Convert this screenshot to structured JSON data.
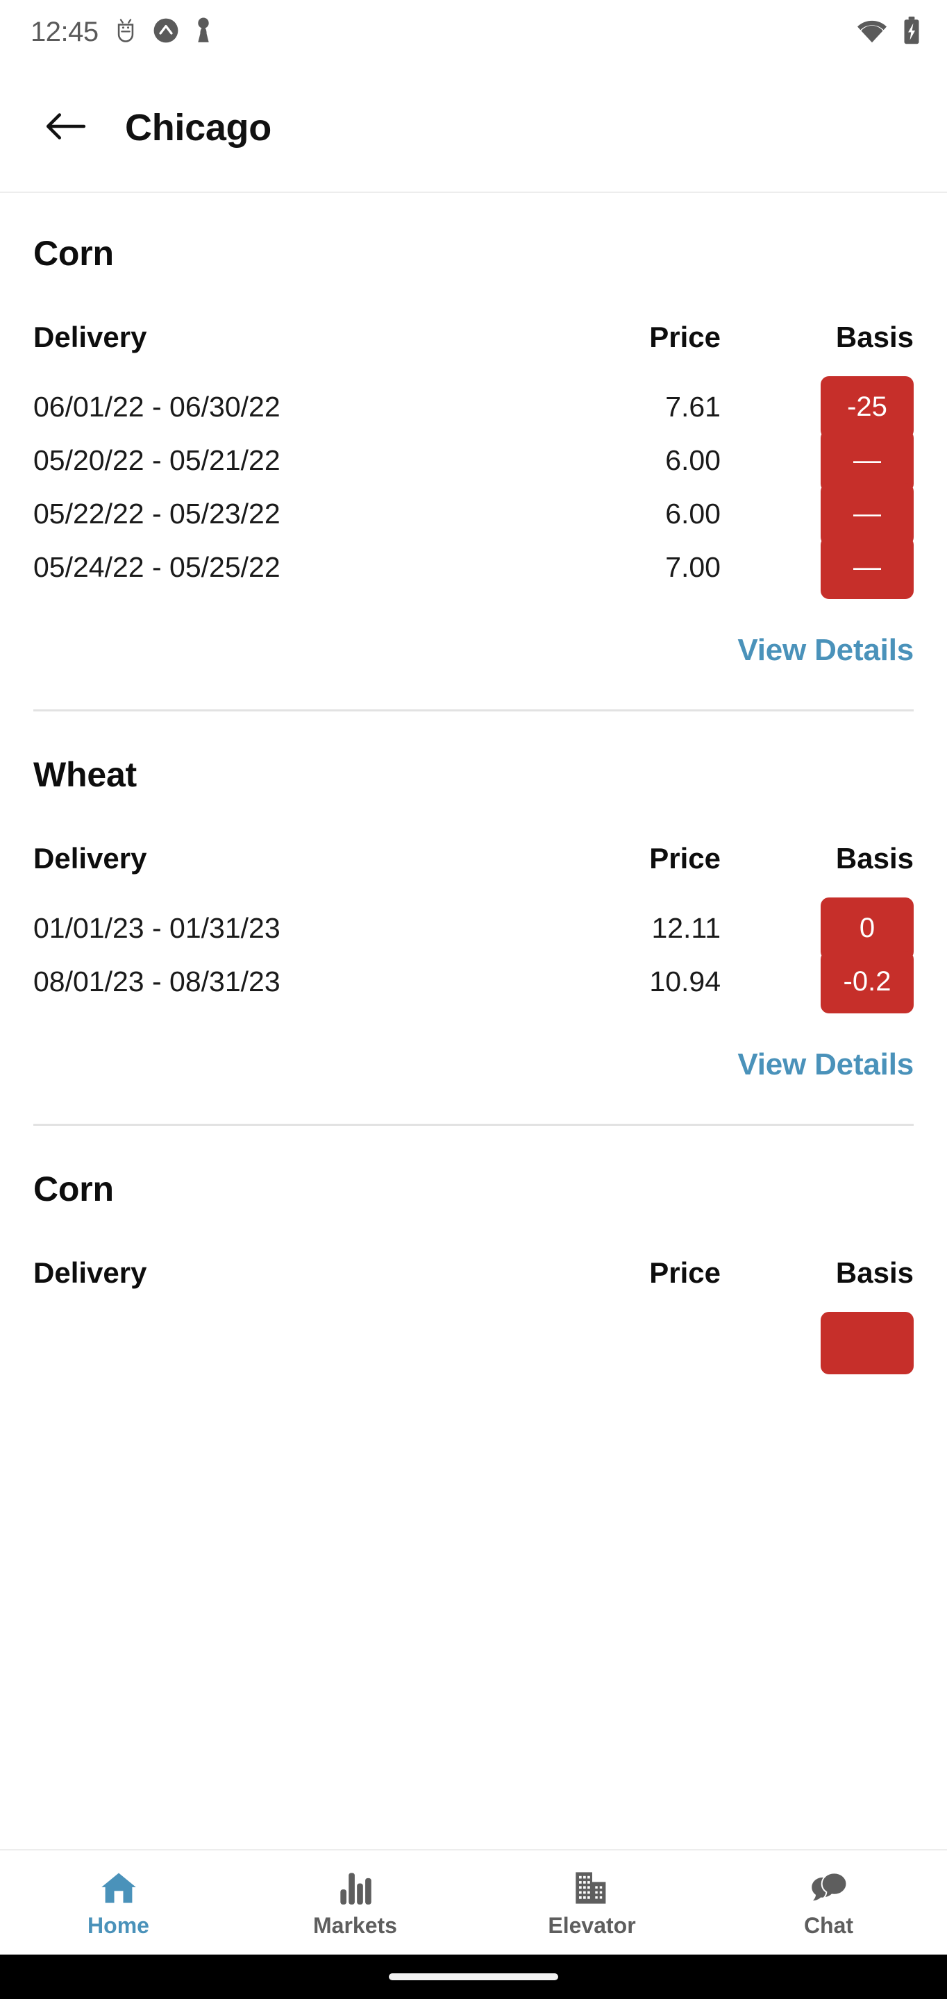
{
  "statusbar": {
    "time": "12:45",
    "icons": [
      "android-debug-icon",
      "arrow-up-circle-icon",
      "chess-pawn-icon"
    ],
    "right_icons": [
      "wifi-icon",
      "battery-charging-icon"
    ]
  },
  "appbar": {
    "back_label": "back-arrow",
    "title": "Chicago"
  },
  "theme": {
    "accent_blue": "#4a92ba",
    "badge_red": "#c62f2a",
    "text_dark": "#0d0d0d",
    "divider": "#e2e2e2"
  },
  "columns": {
    "delivery": "Delivery",
    "price": "Price",
    "basis": "Basis"
  },
  "view_details_label": "View Details",
  "sections": [
    {
      "title": "Corn",
      "rows": [
        {
          "delivery": "06/01/22 - 06/30/22",
          "price": "7.61",
          "basis": "-25"
        },
        {
          "delivery": "05/20/22 - 05/21/22",
          "price": "6.00",
          "basis": "—"
        },
        {
          "delivery": "05/22/22 - 05/23/22",
          "price": "6.00",
          "basis": "—"
        },
        {
          "delivery": "05/24/22 - 05/25/22",
          "price": "7.00",
          "basis": "—"
        }
      ],
      "has_view_details": true
    },
    {
      "title": "Wheat",
      "rows": [
        {
          "delivery": "01/01/23 - 01/31/23",
          "price": "12.11",
          "basis": "0"
        },
        {
          "delivery": "08/01/23 - 08/31/23",
          "price": "10.94",
          "basis": "-0.2"
        }
      ],
      "has_view_details": true
    },
    {
      "title": "Corn",
      "rows": [],
      "has_view_details": false
    }
  ],
  "bottomnav": {
    "items": [
      {
        "label": "Home",
        "icon": "home-icon",
        "active": true
      },
      {
        "label": "Markets",
        "icon": "bar-chart-icon",
        "active": false
      },
      {
        "label": "Elevator",
        "icon": "building-icon",
        "active": false
      },
      {
        "label": "Chat",
        "icon": "chat-icon",
        "active": false
      }
    ]
  }
}
